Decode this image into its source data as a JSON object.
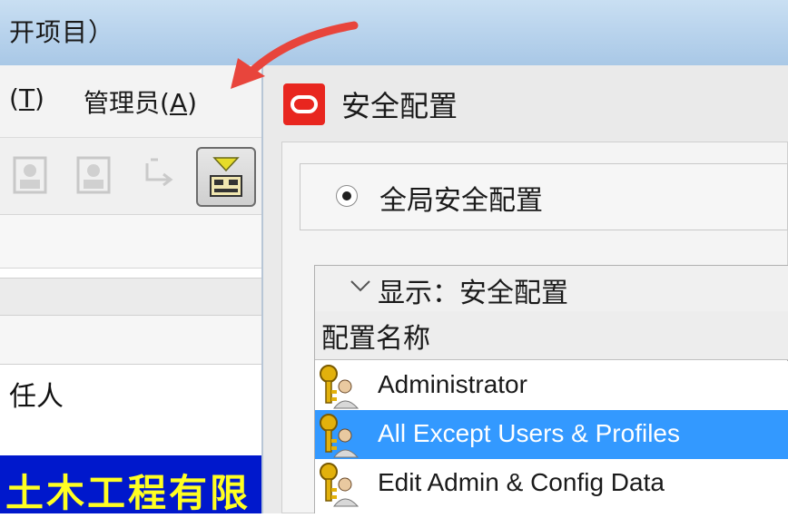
{
  "background_window": {
    "title_fragment": "开项目）",
    "menus": {
      "tools_fragment": "(T)",
      "tools_key": "T",
      "admin": "管理员(A)",
      "admin_key": "A"
    },
    "toolbar_icons": [
      "user-disabled-icon",
      "user-disabled-icon",
      "refresh-disabled-icon",
      "filter-icon"
    ],
    "table_cell": "任人",
    "company_banner": "土木工程有限"
  },
  "dialog": {
    "title": "安全配置",
    "icon": "oracle-icon",
    "radio_label": "全局安全配置",
    "list_header": "显示：安全配置",
    "column_header": "配置名称",
    "rows": [
      {
        "label": "Administrator",
        "icon": "key-user-icon",
        "selected": false
      },
      {
        "label": "All Except Users & Profiles",
        "icon": "key-user-icon",
        "selected": true
      },
      {
        "label": "Edit Admin & Config Data",
        "icon": "key-user-icon",
        "selected": false
      }
    ]
  },
  "colors": {
    "selection": "#3399ff",
    "banner_bg": "#0018cc",
    "banner_text": "#ffff22",
    "arrow": "#e8453c",
    "oracle_red": "#e8261f"
  }
}
